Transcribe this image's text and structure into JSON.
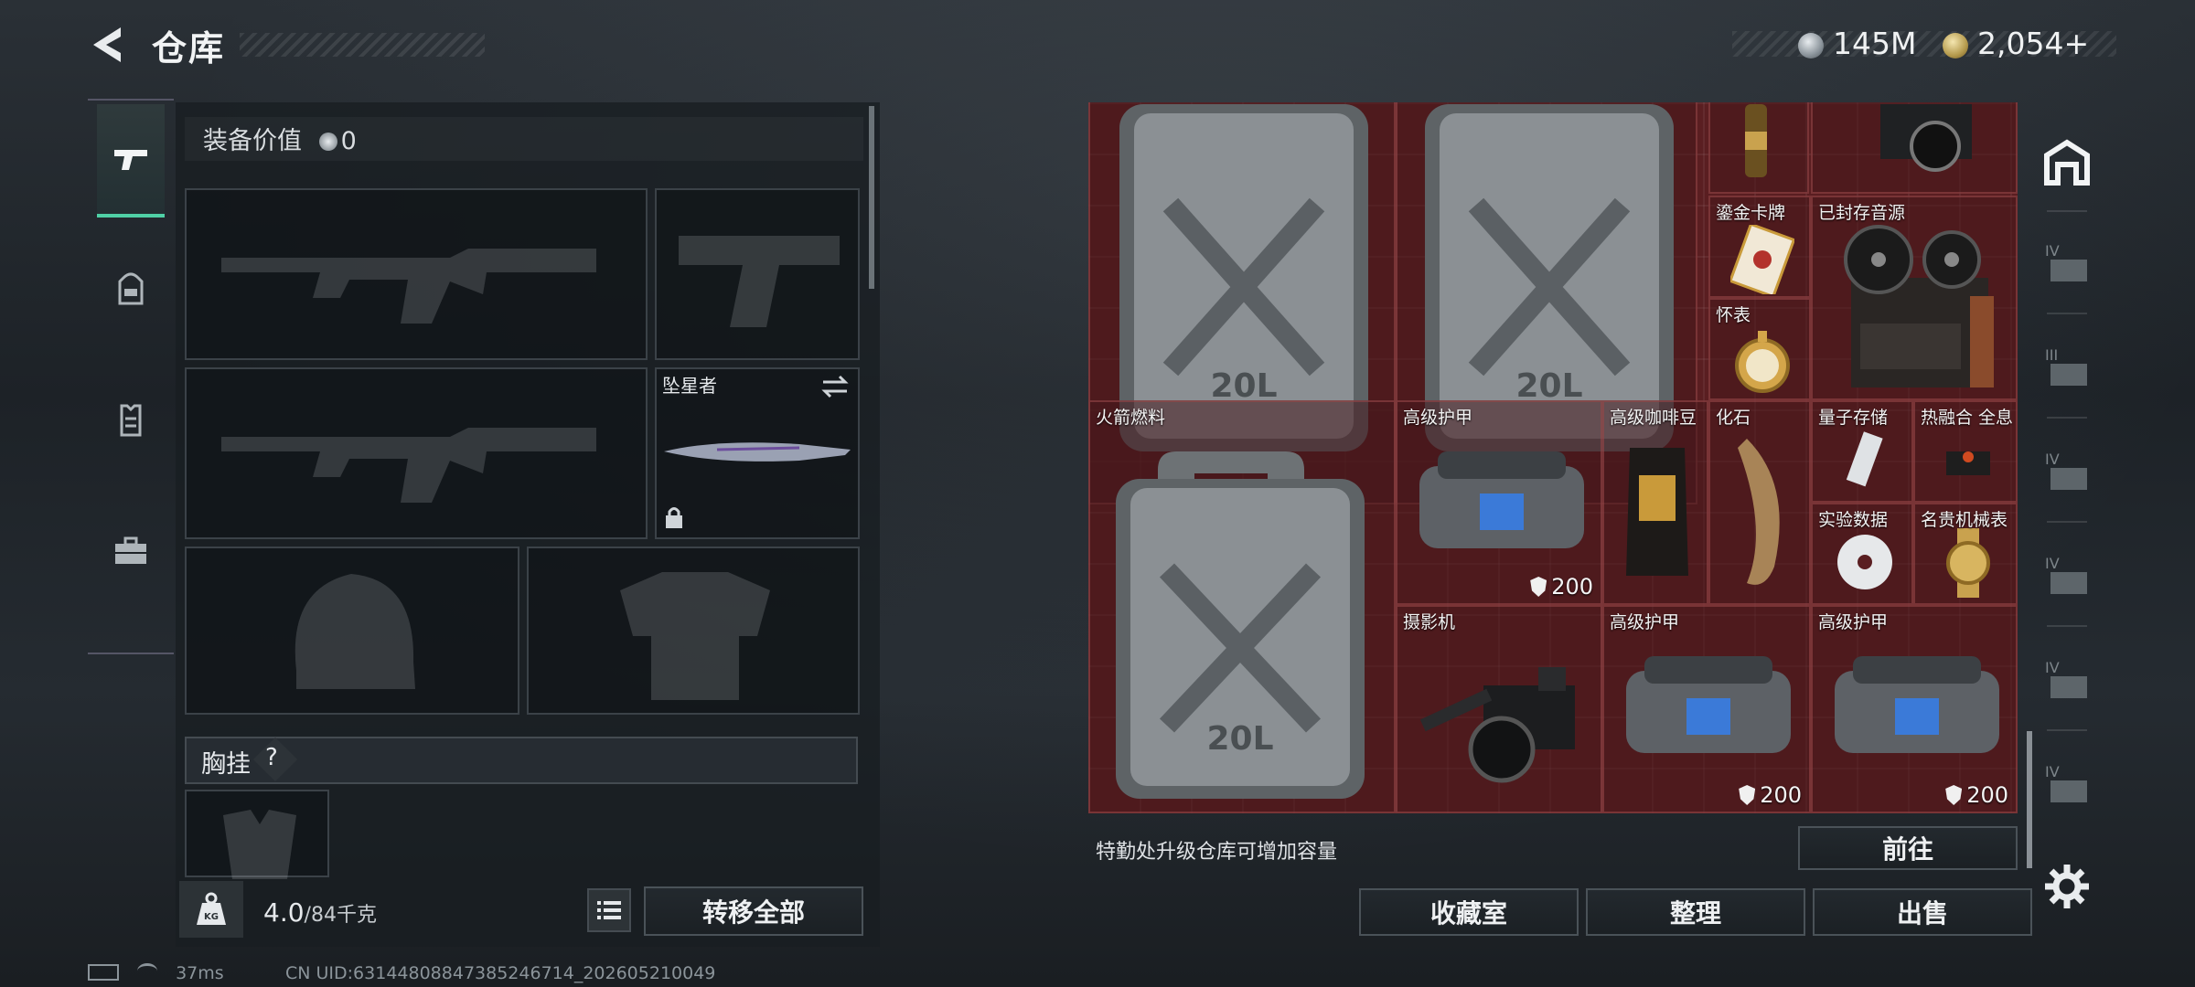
{
  "header": {
    "title": "仓库",
    "currency_silver": "145M",
    "currency_gold": "2,054+"
  },
  "tabs": [
    "weapons",
    "backpack",
    "armor",
    "case"
  ],
  "equipment": {
    "value_label": "装备价值",
    "value": "0",
    "knife_name": "坠星者",
    "chest_rig_label": "胸挂",
    "chest_rig_help": "?"
  },
  "footer_left": {
    "weight_current": "4.0",
    "weight_max": "/84千克",
    "transfer_all": "转移全部"
  },
  "stash": {
    "items": [
      {
        "name": "",
        "value": ""
      },
      {
        "name": "",
        "value": ""
      },
      {
        "name": "鎏金卡牌",
        "value": ""
      },
      {
        "name": "已封存音源",
        "value": ""
      },
      {
        "name": "怀表",
        "value": ""
      },
      {
        "name": "火箭燃料",
        "value": ""
      },
      {
        "name": "高级护甲",
        "value": "200"
      },
      {
        "name": "高级咖啡豆",
        "value": ""
      },
      {
        "name": "化石",
        "value": ""
      },
      {
        "name": "量子存储",
        "value": ""
      },
      {
        "name": "热融合 全息",
        "value": ""
      },
      {
        "name": "实验数据",
        "value": ""
      },
      {
        "name": "名贵机械表",
        "value": ""
      },
      {
        "name": "摄影机",
        "value": ""
      },
      {
        "name": "高级护甲",
        "value": "200"
      },
      {
        "name": "高级护甲",
        "value": "200"
      }
    ],
    "hint": "特勤处升级仓库可增加容量",
    "goto": "前往"
  },
  "actions": {
    "collection": "收藏室",
    "sort": "整理",
    "sell": "出售"
  },
  "rail": [
    "home-base",
    "IV",
    "III",
    "IV",
    "IV",
    "IV",
    "IV",
    "settings"
  ],
  "status": {
    "ping": "37ms",
    "uid": "CN UID:6314480884738524671​4_202605210049"
  }
}
